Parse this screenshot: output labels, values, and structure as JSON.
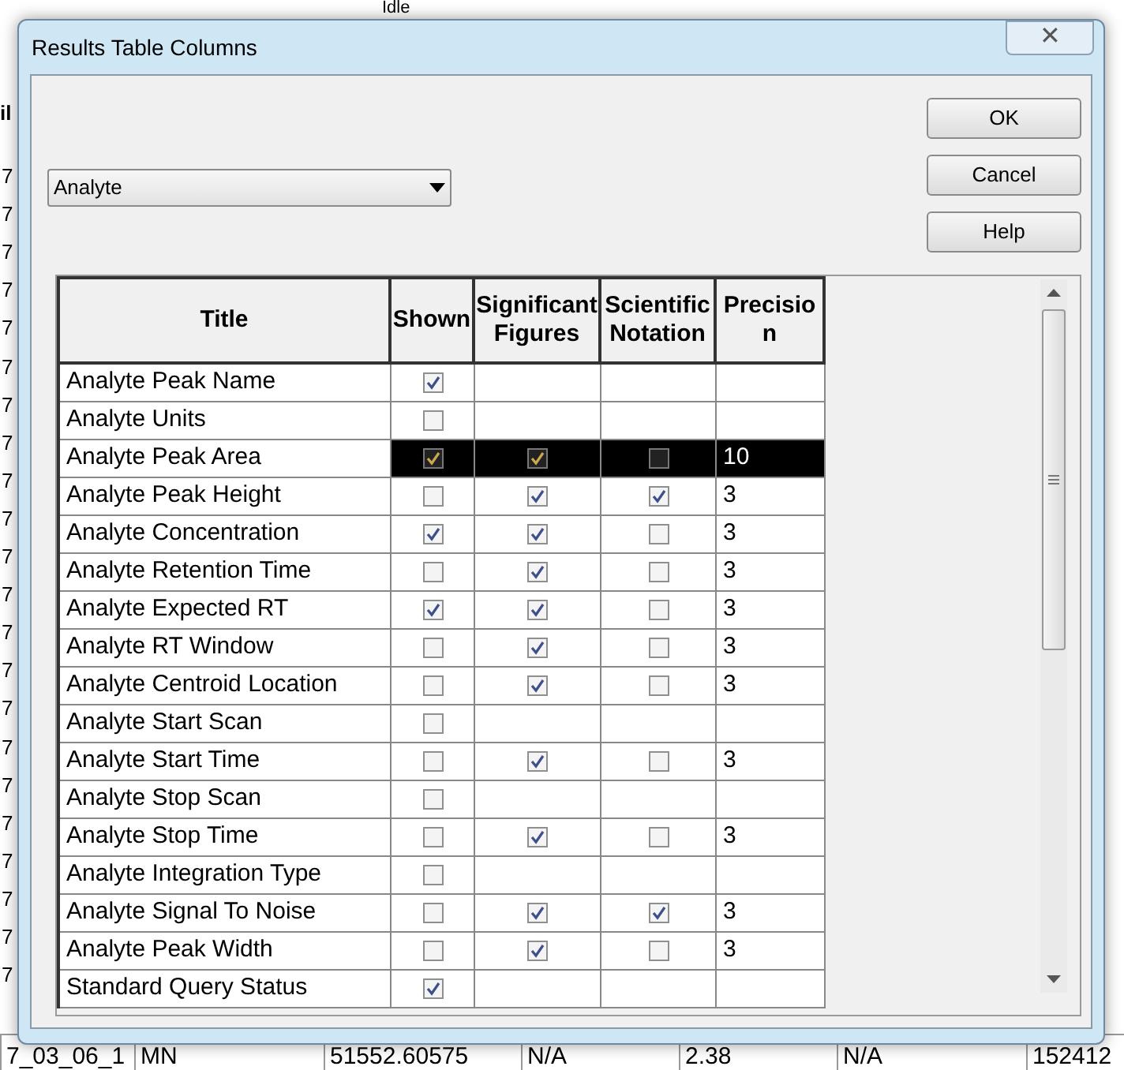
{
  "background": {
    "status": "Idle",
    "header_fragment": "il",
    "row_fragments": [
      "7",
      "7",
      "7",
      "7",
      "7",
      "7",
      "7",
      "7",
      "7",
      "7",
      "7",
      "7",
      "7",
      "7",
      "7",
      "7",
      "7",
      "7",
      "7",
      "7",
      "7",
      "7"
    ],
    "bottom_row": [
      "7_03_06_1",
      "MN",
      "51552.60575",
      "N/A",
      "2.38",
      "N/A",
      "152412"
    ]
  },
  "window": {
    "title": "Results Table Columns",
    "close": "✕"
  },
  "dropdown": {
    "value": "Analyte"
  },
  "buttons": [
    "OK",
    "Cancel",
    "Help"
  ],
  "table": {
    "columns": [
      "Title",
      "Shown",
      "Significant Figures",
      "Scientific Notation",
      "Precision"
    ],
    "rows": [
      {
        "title": "Analyte Peak Name",
        "selected": false,
        "shown": true
      },
      {
        "title": "Analyte Units",
        "selected": false,
        "shown": false
      },
      {
        "title": "Analyte Peak Area",
        "selected": true,
        "shown": true,
        "significant_figures": true,
        "scientific_notation": false,
        "precision": "10"
      },
      {
        "title": "Analyte Peak Height",
        "selected": false,
        "shown": false,
        "significant_figures": true,
        "scientific_notation": true,
        "precision": "3"
      },
      {
        "title": "Analyte Concentration",
        "selected": false,
        "shown": true,
        "significant_figures": true,
        "scientific_notation": false,
        "precision": "3"
      },
      {
        "title": "Analyte Retention Time",
        "selected": false,
        "shown": false,
        "significant_figures": true,
        "scientific_notation": false,
        "precision": "3"
      },
      {
        "title": "Analyte Expected RT",
        "selected": false,
        "shown": true,
        "significant_figures": true,
        "scientific_notation": false,
        "precision": "3"
      },
      {
        "title": "Analyte RT Window",
        "selected": false,
        "shown": false,
        "significant_figures": true,
        "scientific_notation": false,
        "precision": "3"
      },
      {
        "title": "Analyte Centroid Location",
        "selected": false,
        "shown": false,
        "significant_figures": true,
        "scientific_notation": false,
        "precision": "3"
      },
      {
        "title": "Analyte Start Scan",
        "selected": false,
        "shown": false
      },
      {
        "title": "Analyte Start Time",
        "selected": false,
        "shown": false,
        "significant_figures": true,
        "scientific_notation": false,
        "precision": "3"
      },
      {
        "title": "Analyte Stop Scan",
        "selected": false,
        "shown": false
      },
      {
        "title": "Analyte Stop Time",
        "selected": false,
        "shown": false,
        "significant_figures": true,
        "scientific_notation": false,
        "precision": "3"
      },
      {
        "title": "Analyte Integration Type",
        "selected": false,
        "shown": false
      },
      {
        "title": "Analyte Signal To Noise",
        "selected": false,
        "shown": false,
        "significant_figures": true,
        "scientific_notation": true,
        "precision": "3"
      },
      {
        "title": "Analyte Peak Width",
        "selected": false,
        "shown": false,
        "significant_figures": true,
        "scientific_notation": false,
        "precision": "3"
      },
      {
        "title": "Standard Query Status",
        "selected": false,
        "shown": true
      }
    ]
  }
}
